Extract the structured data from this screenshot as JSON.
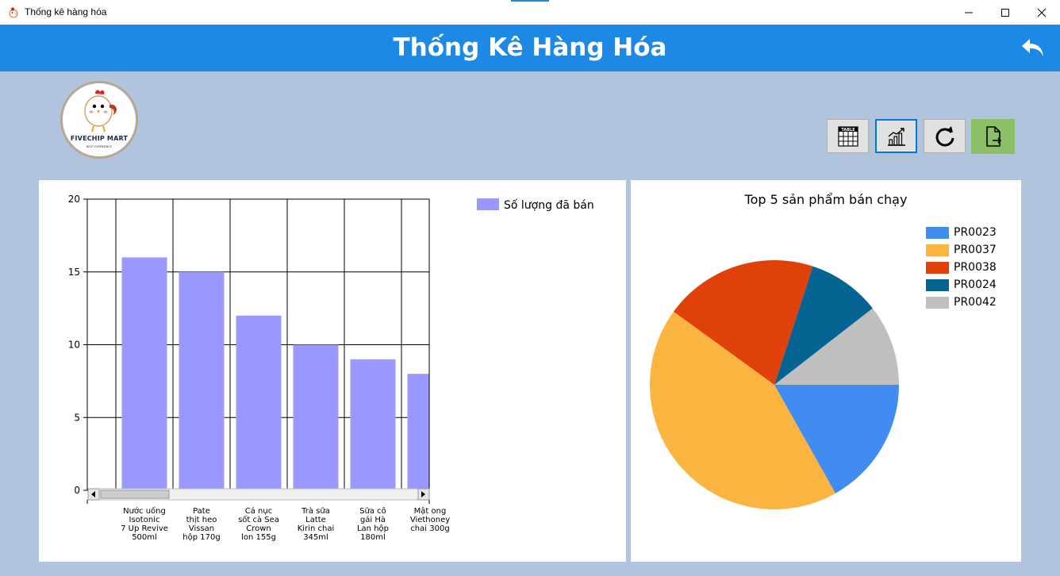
{
  "window": {
    "title": "Thống kê hàng hóa"
  },
  "header": {
    "title": "Thống Kê Hàng Hóa"
  },
  "logo": {
    "brand": "FIVECHIP MART",
    "tagline": "BEST EXPERIENCE"
  },
  "toolbar": {
    "buttons": [
      {
        "name": "table-view",
        "icon": "table-icon",
        "label": "TABLE",
        "active": false
      },
      {
        "name": "chart-view",
        "icon": "chart-icon",
        "active": true
      },
      {
        "name": "refresh",
        "icon": "refresh-icon",
        "active": false
      },
      {
        "name": "export",
        "icon": "export-file-icon",
        "active": false
      }
    ]
  },
  "colors": {
    "header": "#1e88e5",
    "background": "#b0c4de",
    "bar": "#9999ff",
    "export_button": "#8cc068"
  },
  "chart_data": [
    {
      "type": "bar",
      "categories": [
        [
          "Nước uống",
          "Isotonic",
          "7 Up Revive",
          "500ml"
        ],
        [
          "Pate",
          "thịt heo",
          "Vissan",
          "hộp 170g"
        ],
        [
          "Cá nục",
          "sốt cà Sea",
          "Crown",
          "lon 155g"
        ],
        [
          "Trà sữa",
          "Latte",
          "Kirin chai",
          "345ml"
        ],
        [
          "Sữa cô",
          "gái Hà",
          "Lan hộp",
          "180ml"
        ],
        [
          "Mật ong",
          "Viethoney",
          "chai 300g"
        ]
      ],
      "series": [
        {
          "name": "Số lượng đã bán",
          "color": "#9999ff",
          "values": [
            16,
            15,
            12,
            10,
            9,
            8
          ]
        }
      ],
      "ylim": [
        0,
        20
      ],
      "yticks": [
        0,
        5,
        10,
        15,
        20
      ],
      "grid": true,
      "legend": "top-right",
      "scrollbar": true
    },
    {
      "type": "pie",
      "title": "Top 5 sản phẩm bán chạy",
      "labels": [
        "PR0023",
        "PR0037",
        "PR0038",
        "PR0024",
        "PR0042"
      ],
      "values": [
        16,
        41,
        19,
        9,
        10
      ],
      "colors": [
        "#418cf0",
        "#fcb441",
        "#e0400a",
        "#056492",
        "#bfbfbf"
      ],
      "legend": "top-right"
    }
  ]
}
